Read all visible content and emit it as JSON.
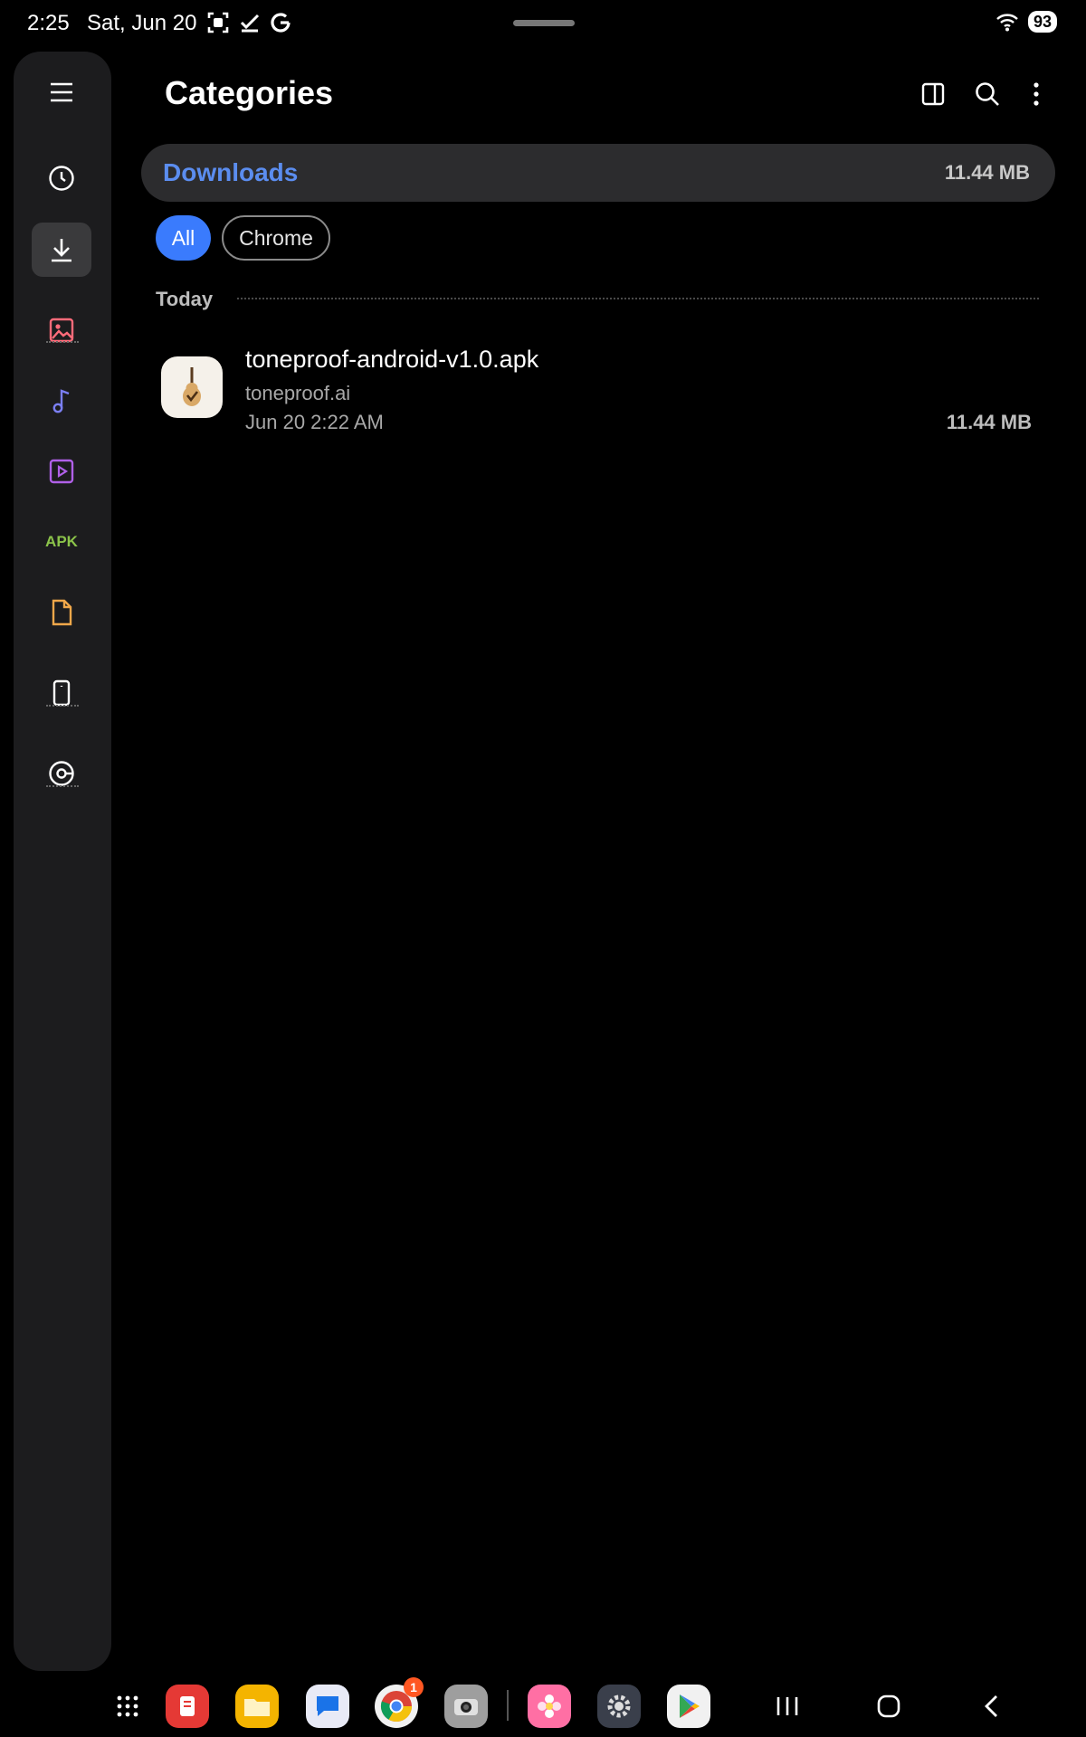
{
  "status_bar": {
    "time": "2:25",
    "date": "Sat, Jun 20",
    "battery": "93"
  },
  "sidebar": {
    "items": [
      {
        "name": "recent",
        "icon": "clock-icon"
      },
      {
        "name": "downloads",
        "icon": "download-icon",
        "active": true
      },
      {
        "name": "images",
        "icon": "image-icon"
      },
      {
        "name": "audio",
        "icon": "music-note-icon"
      },
      {
        "name": "videos",
        "icon": "video-icon"
      },
      {
        "name": "apk",
        "label": "APK"
      },
      {
        "name": "documents",
        "icon": "document-icon"
      },
      {
        "name": "internal-storage",
        "icon": "phone-icon"
      },
      {
        "name": "storage-analysis",
        "icon": "storage-icon"
      }
    ]
  },
  "header": {
    "title": "Categories"
  },
  "downloads": {
    "title": "Downloads",
    "size": "11.44 MB"
  },
  "filters": {
    "all": "All",
    "chrome": "Chrome"
  },
  "section": {
    "label": "Today"
  },
  "files": [
    {
      "name": "toneproof-android-v1.0.apk",
      "source": "toneproof.ai",
      "date": "Jun 20 2:22 AM",
      "size": "11.44 MB"
    }
  ],
  "dock": {
    "chrome_badge": "1"
  },
  "colors": {
    "accent": "#3a7bfd",
    "downloads_title": "#5b8def",
    "images": "#ff6b7a",
    "audio": "#7b7ff5",
    "video": "#b060e8",
    "apk": "#8bc34a",
    "documents": "#f0a74a"
  }
}
